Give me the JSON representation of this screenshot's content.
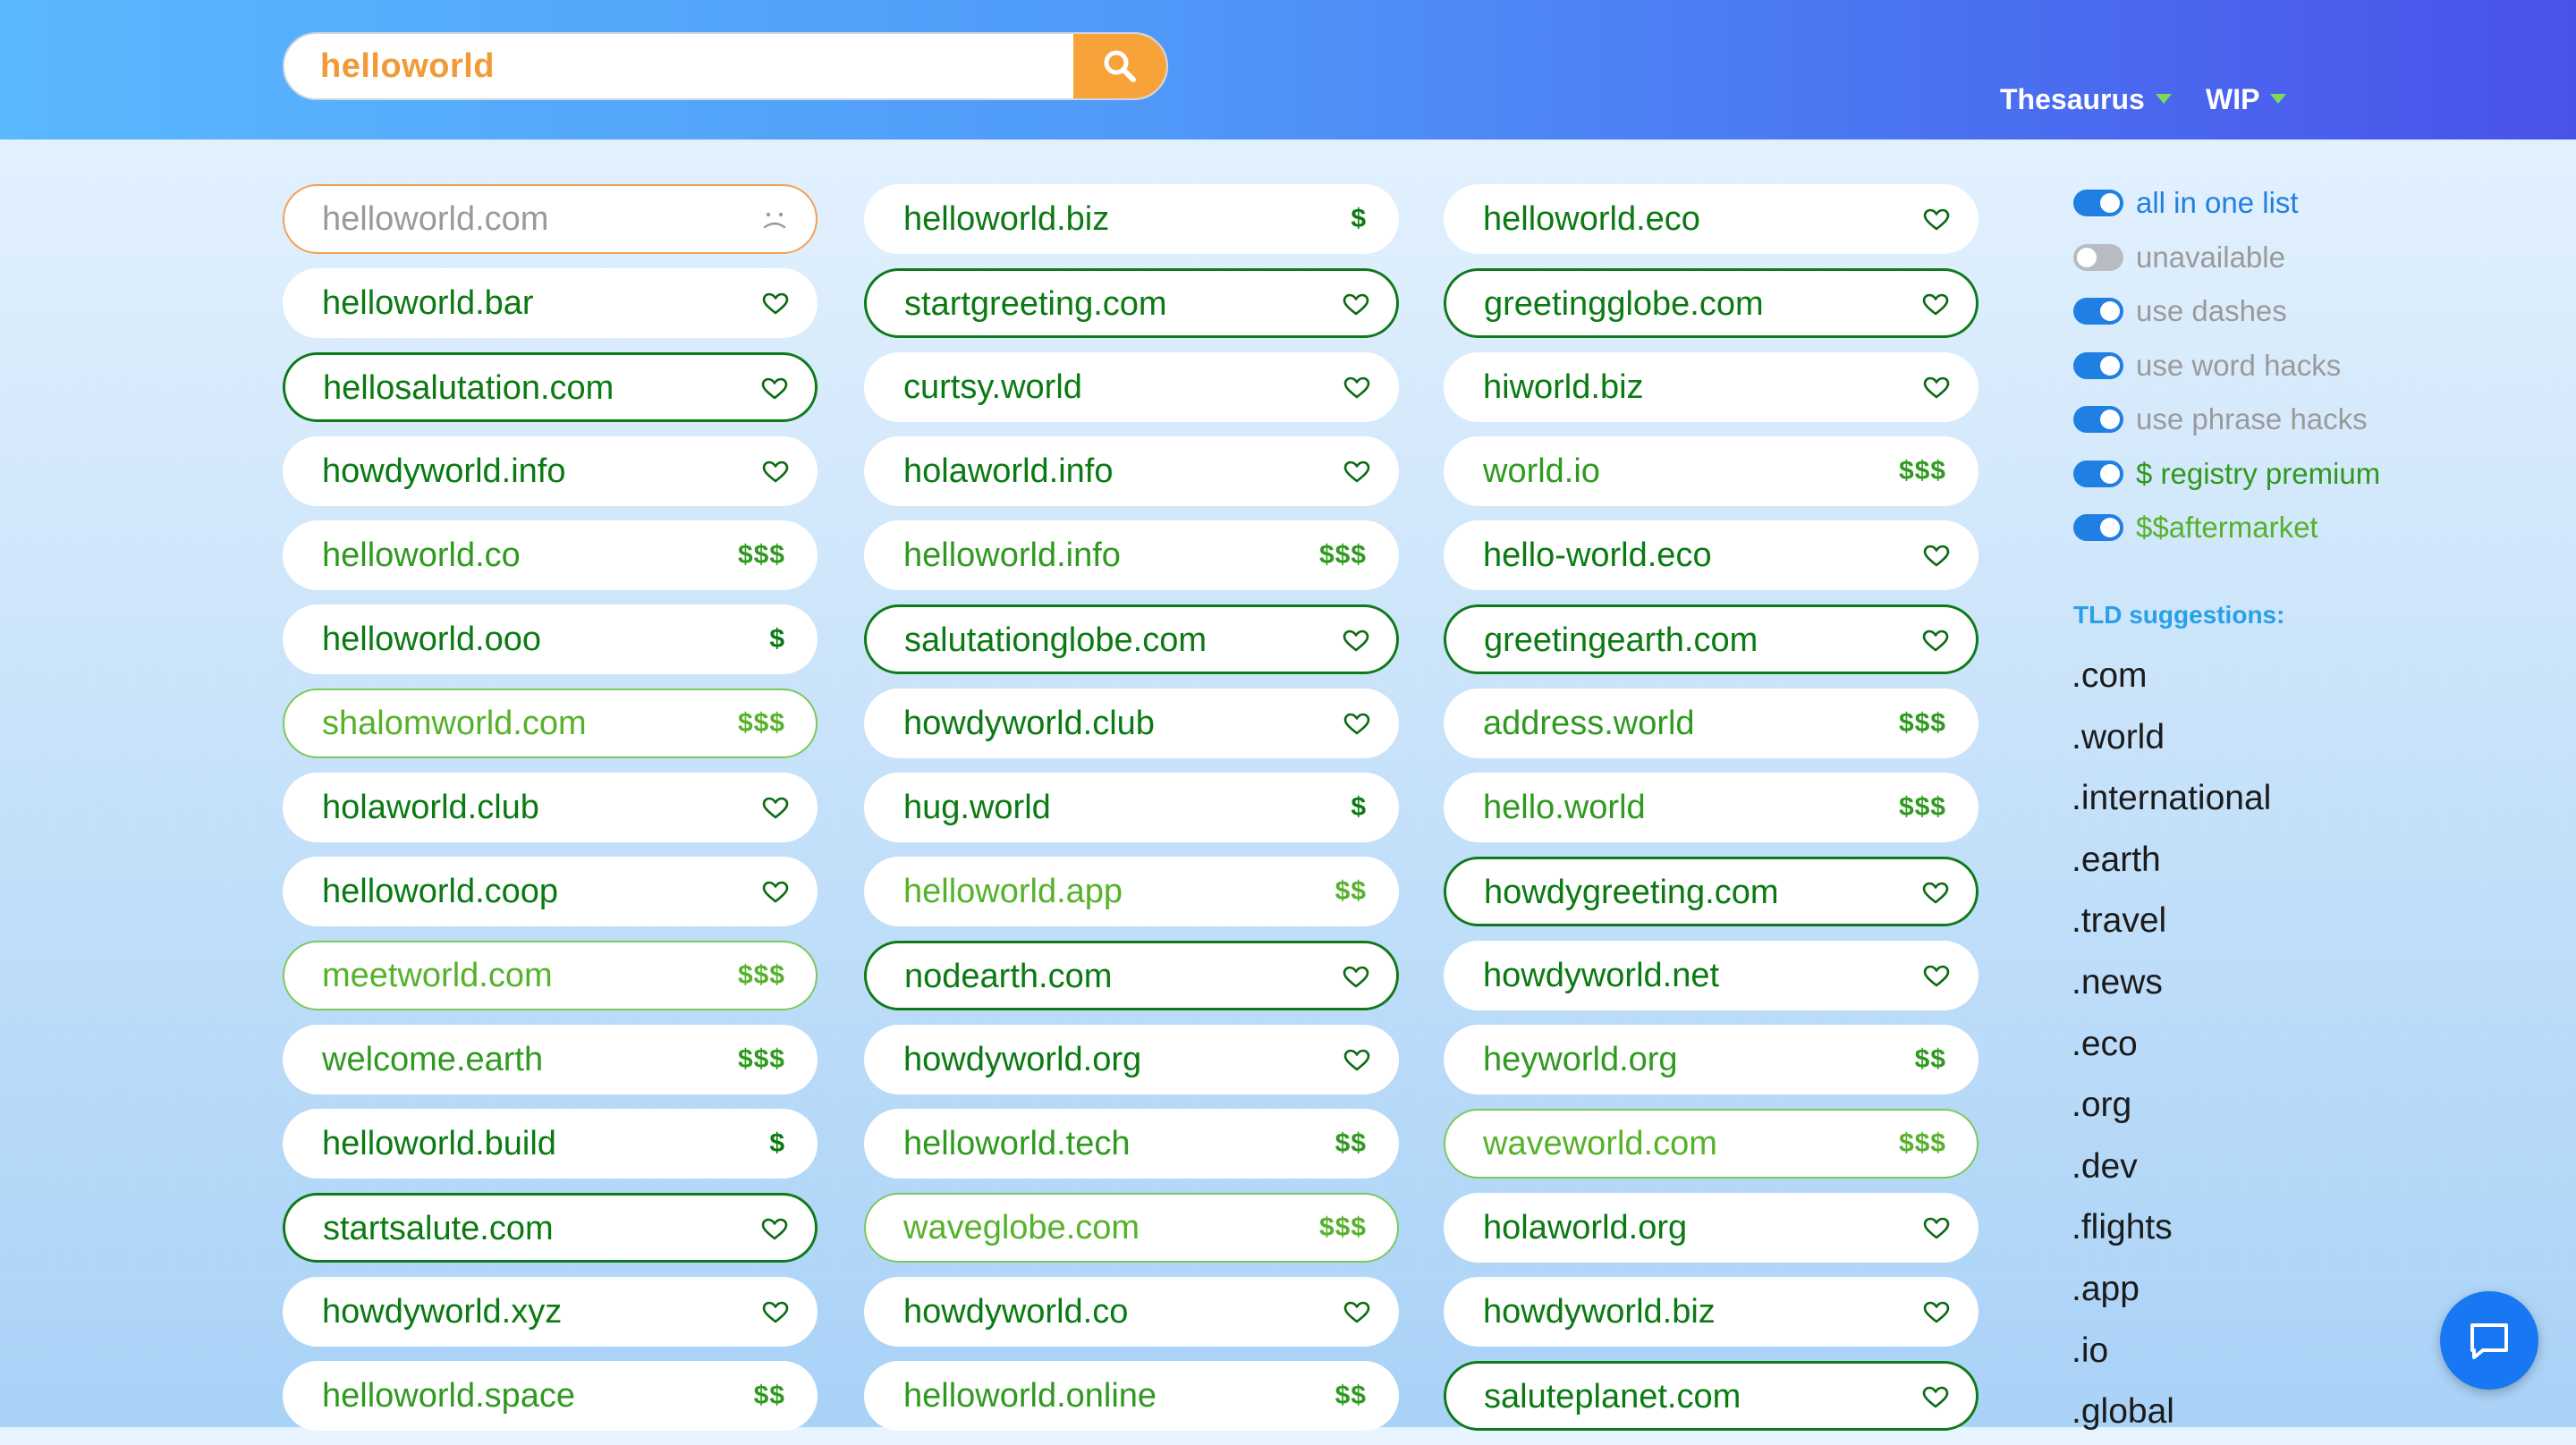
{
  "search": {
    "query": "helloworld",
    "tld": ".com"
  },
  "menu": {
    "thesaurus": "Thesaurus",
    "wip": "WIP"
  },
  "columns": [
    [
      {
        "name": "helloworld.com",
        "badge": "frown",
        "price": "",
        "border": "orange",
        "color": "gray"
      },
      {
        "name": "helloworld.bar",
        "badge": "heart",
        "price": "",
        "border": "none",
        "color": "dark"
      },
      {
        "name": "hellosalutation.com",
        "badge": "heart",
        "price": "",
        "border": "dark",
        "color": "dark"
      },
      {
        "name": "howdyworld.info",
        "badge": "heart",
        "price": "",
        "border": "none",
        "color": "dark"
      },
      {
        "name": "helloworld.co",
        "badge": "price",
        "price": "$$$",
        "border": "none",
        "color": "mid"
      },
      {
        "name": "helloworld.ooo",
        "badge": "price",
        "price": "$",
        "border": "none",
        "color": "dark"
      },
      {
        "name": "shalomworld.com",
        "badge": "price",
        "price": "$$$",
        "border": "light",
        "color": "light"
      },
      {
        "name": "holaworld.club",
        "badge": "heart",
        "price": "",
        "border": "none",
        "color": "dark"
      },
      {
        "name": "helloworld.coop",
        "badge": "heart",
        "price": "",
        "border": "none",
        "color": "dark"
      },
      {
        "name": "meetworld.com",
        "badge": "price",
        "price": "$$$",
        "border": "light",
        "color": "light"
      },
      {
        "name": "welcome.earth",
        "badge": "price",
        "price": "$$$",
        "border": "none",
        "color": "mid"
      },
      {
        "name": "helloworld.build",
        "badge": "price",
        "price": "$",
        "border": "none",
        "color": "dark"
      },
      {
        "name": "startsalute.com",
        "badge": "heart",
        "price": "",
        "border": "dark",
        "color": "dark"
      },
      {
        "name": "howdyworld.xyz",
        "badge": "heart",
        "price": "",
        "border": "none",
        "color": "dark"
      },
      {
        "name": "helloworld.space",
        "badge": "price",
        "price": "$$",
        "border": "none",
        "color": "mid"
      }
    ],
    [
      {
        "name": "helloworld.biz",
        "badge": "price",
        "price": "$",
        "border": "none",
        "color": "dark"
      },
      {
        "name": "startgreeting.com",
        "badge": "heart",
        "price": "",
        "border": "dark",
        "color": "dark"
      },
      {
        "name": "curtsy.world",
        "badge": "heart",
        "price": "",
        "border": "none",
        "color": "dark"
      },
      {
        "name": "holaworld.info",
        "badge": "heart",
        "price": "",
        "border": "none",
        "color": "dark"
      },
      {
        "name": "helloworld.info",
        "badge": "price",
        "price": "$$$",
        "border": "none",
        "color": "mid"
      },
      {
        "name": "salutationglobe.com",
        "badge": "heart",
        "price": "",
        "border": "dark",
        "color": "dark"
      },
      {
        "name": "howdyworld.club",
        "badge": "heart",
        "price": "",
        "border": "none",
        "color": "dark"
      },
      {
        "name": "hug.world",
        "badge": "price",
        "price": "$",
        "border": "none",
        "color": "dark"
      },
      {
        "name": "helloworld.app",
        "badge": "price",
        "price": "$$",
        "border": "none",
        "color": "light"
      },
      {
        "name": "nodearth.com",
        "badge": "heart",
        "price": "",
        "border": "dark",
        "color": "dark"
      },
      {
        "name": "howdyworld.org",
        "badge": "heart",
        "price": "",
        "border": "none",
        "color": "dark"
      },
      {
        "name": "helloworld.tech",
        "badge": "price",
        "price": "$$",
        "border": "none",
        "color": "mid"
      },
      {
        "name": "waveglobe.com",
        "badge": "price",
        "price": "$$$",
        "border": "light",
        "color": "light"
      },
      {
        "name": "howdyworld.co",
        "badge": "heart",
        "price": "",
        "border": "none",
        "color": "dark"
      },
      {
        "name": "helloworld.online",
        "badge": "price",
        "price": "$$",
        "border": "none",
        "color": "mid"
      }
    ],
    [
      {
        "name": "helloworld.eco",
        "badge": "heart",
        "price": "",
        "border": "none",
        "color": "dark"
      },
      {
        "name": "greetingglobe.com",
        "badge": "heart",
        "price": "",
        "border": "dark",
        "color": "dark"
      },
      {
        "name": "hiworld.biz",
        "badge": "heart",
        "price": "",
        "border": "none",
        "color": "dark"
      },
      {
        "name": "world.io",
        "badge": "price",
        "price": "$$$",
        "border": "none",
        "color": "mid"
      },
      {
        "name": "hello-world.eco",
        "badge": "heart",
        "price": "",
        "border": "none",
        "color": "dark"
      },
      {
        "name": "greetingearth.com",
        "badge": "heart",
        "price": "",
        "border": "dark",
        "color": "dark"
      },
      {
        "name": "address.world",
        "badge": "price",
        "price": "$$$",
        "border": "none",
        "color": "mid"
      },
      {
        "name": "hello.world",
        "badge": "price",
        "price": "$$$",
        "border": "none",
        "color": "mid"
      },
      {
        "name": "howdygreeting.com",
        "badge": "heart",
        "price": "",
        "border": "dark",
        "color": "dark"
      },
      {
        "name": "howdyworld.net",
        "badge": "heart",
        "price": "",
        "border": "none",
        "color": "dark"
      },
      {
        "name": "heyworld.org",
        "badge": "price",
        "price": "$$",
        "border": "none",
        "color": "mid"
      },
      {
        "name": "waveworld.com",
        "badge": "price",
        "price": "$$$",
        "border": "light",
        "color": "light"
      },
      {
        "name": "holaworld.org",
        "badge": "heart",
        "price": "",
        "border": "none",
        "color": "dark"
      },
      {
        "name": "howdyworld.biz",
        "badge": "heart",
        "price": "",
        "border": "none",
        "color": "dark"
      },
      {
        "name": "saluteplanet.com",
        "badge": "heart",
        "price": "",
        "border": "dark",
        "color": "dark"
      }
    ]
  ],
  "toggles": [
    {
      "label": "all in one list",
      "on": true,
      "color": "#1f7fe3"
    },
    {
      "label": "unavailable",
      "on": false,
      "color": "#9a9a9a"
    },
    {
      "label": "use dashes",
      "on": true,
      "color": "#9a9a9a"
    },
    {
      "label": "use word hacks",
      "on": true,
      "color": "#9a9a9a"
    },
    {
      "label": "use phrase hacks",
      "on": true,
      "color": "#9a9a9a"
    },
    {
      "label": "$ registry premium",
      "on": true,
      "color": "#2f9a1f"
    },
    {
      "label": "$$aftermarket",
      "on": true,
      "color": "#56b22a"
    }
  ],
  "tld_heading": "TLD suggestions:",
  "tlds": [
    ".com",
    ".world",
    ".international",
    ".earth",
    ".travel",
    ".news",
    ".eco",
    ".org",
    ".dev",
    ".flights",
    ".app",
    ".io",
    ".global"
  ]
}
